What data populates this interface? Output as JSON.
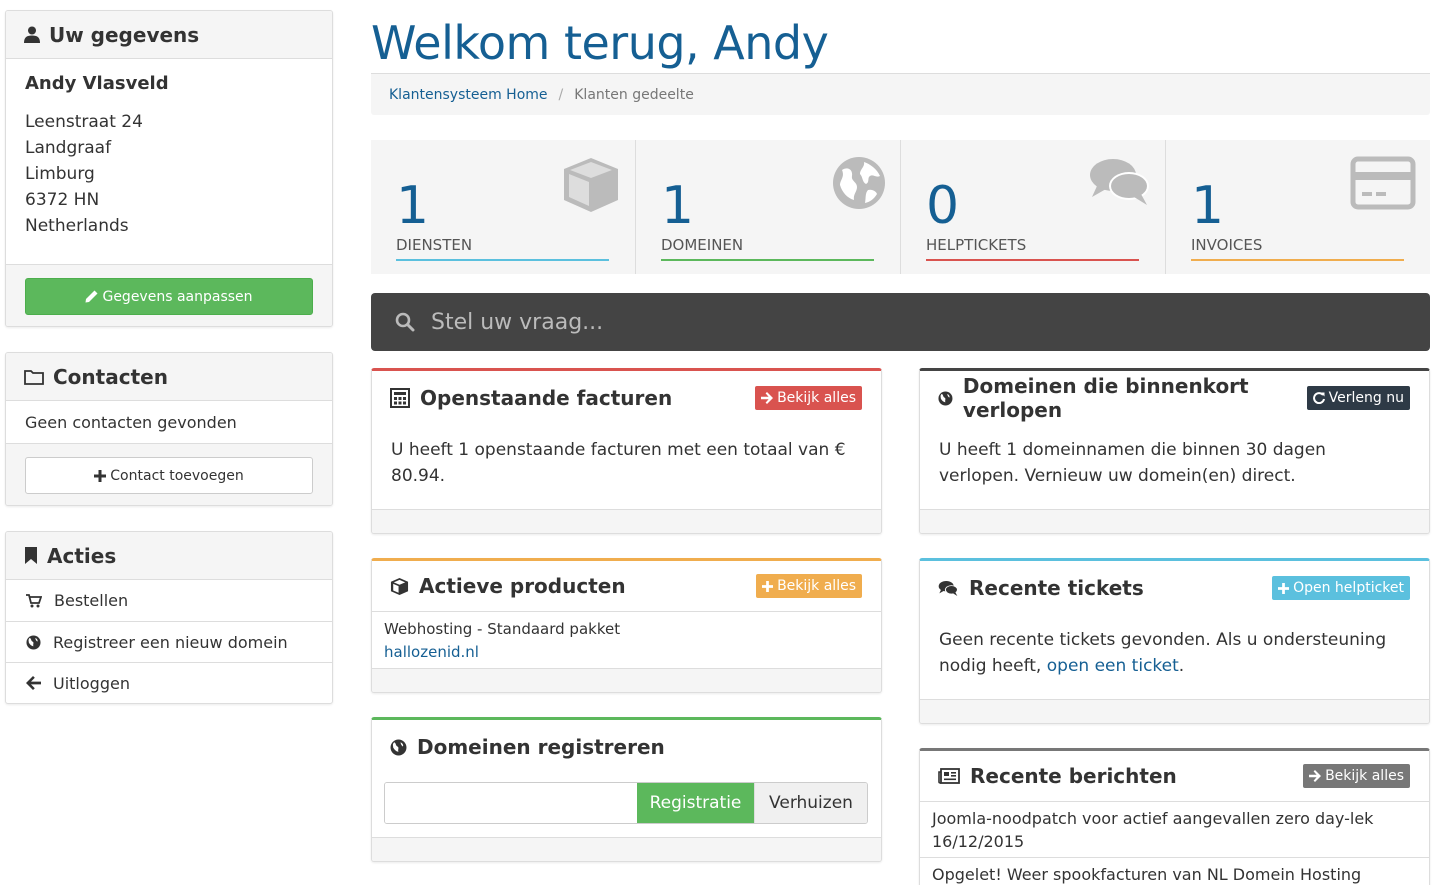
{
  "sidebar": {
    "account": {
      "title": "Uw gegevens",
      "name": "Andy Vlasveld",
      "address": [
        "Leenstraat 24",
        "Landgraaf",
        "Limburg",
        "6372 HN",
        "Netherlands"
      ],
      "edit_button": "Gegevens aanpassen"
    },
    "contacts": {
      "title": "Contacten",
      "empty_text": "Geen contacten gevonden",
      "add_button": "Contact toevoegen"
    },
    "actions": {
      "title": "Acties",
      "items": [
        {
          "label": "Bestellen",
          "icon": "cart-icon"
        },
        {
          "label": "Registreer een nieuw domein",
          "icon": "globe-icon"
        },
        {
          "label": "Uitloggen",
          "icon": "arrow-left-icon"
        }
      ]
    }
  },
  "main": {
    "title": "Welkom terug, Andy",
    "breadcrumb": {
      "home": "Klantensysteem Home",
      "current": "Klanten gedeelte"
    },
    "tiles": [
      {
        "count": "1",
        "label": "DIENSTEN",
        "icon": "cube-icon",
        "color": "#5bc0de"
      },
      {
        "count": "1",
        "label": "DOMEINEN",
        "icon": "globe-icon",
        "color": "#5cb85c"
      },
      {
        "count": "0",
        "label": "HELPTICKETS",
        "icon": "comments-icon",
        "color": "#d9534f"
      },
      {
        "count": "1",
        "label": "INVOICES",
        "icon": "credit-card-icon",
        "color": "#f0ad4e"
      }
    ],
    "search_placeholder": "Stel uw vraag...",
    "invoices": {
      "title": "Openstaande facturen",
      "button": "Bekijk alles",
      "text": "U heeft 1 openstaande facturen met een totaal van € 80.94."
    },
    "domains_expiring": {
      "title": "Domeinen die binnenkort verlopen",
      "button": "Verleng nu",
      "text": "U heeft 1 domeinnamen die binnen 30 dagen verlopen. Vernieuw uw domein(en) direct."
    },
    "products": {
      "title": "Actieve producten",
      "button": "Bekijk alles",
      "item_name": "Webhosting - Standaard pakket",
      "item_domain": "hallozenid.nl"
    },
    "tickets": {
      "title": "Recente tickets",
      "button": "Open helpticket",
      "text": "Geen recente tickets gevonden. Als u ondersteuning nodig heeft,",
      "link": "open een ticket",
      "suffix": "."
    },
    "register": {
      "title": "Domeinen registreren",
      "register_button": "Registratie",
      "transfer_button": "Verhuizen"
    },
    "news": {
      "title": "Recente berichten",
      "button": "Bekijk alles",
      "items": [
        {
          "title": "Joomla-noodpatch voor actief aangevallen zero day-lek",
          "date": "16/12/2015"
        },
        {
          "title": "Opgelet! Weer spookfacturen van NL Domein Hosting",
          "date": ""
        }
      ]
    }
  },
  "colors": {
    "primary": "#155f93",
    "success": "#5cb85c",
    "danger": "#d9534f",
    "warning": "#f0ad4e",
    "info": "#5bc0de",
    "dark": "#444444",
    "muted": "#777777"
  }
}
